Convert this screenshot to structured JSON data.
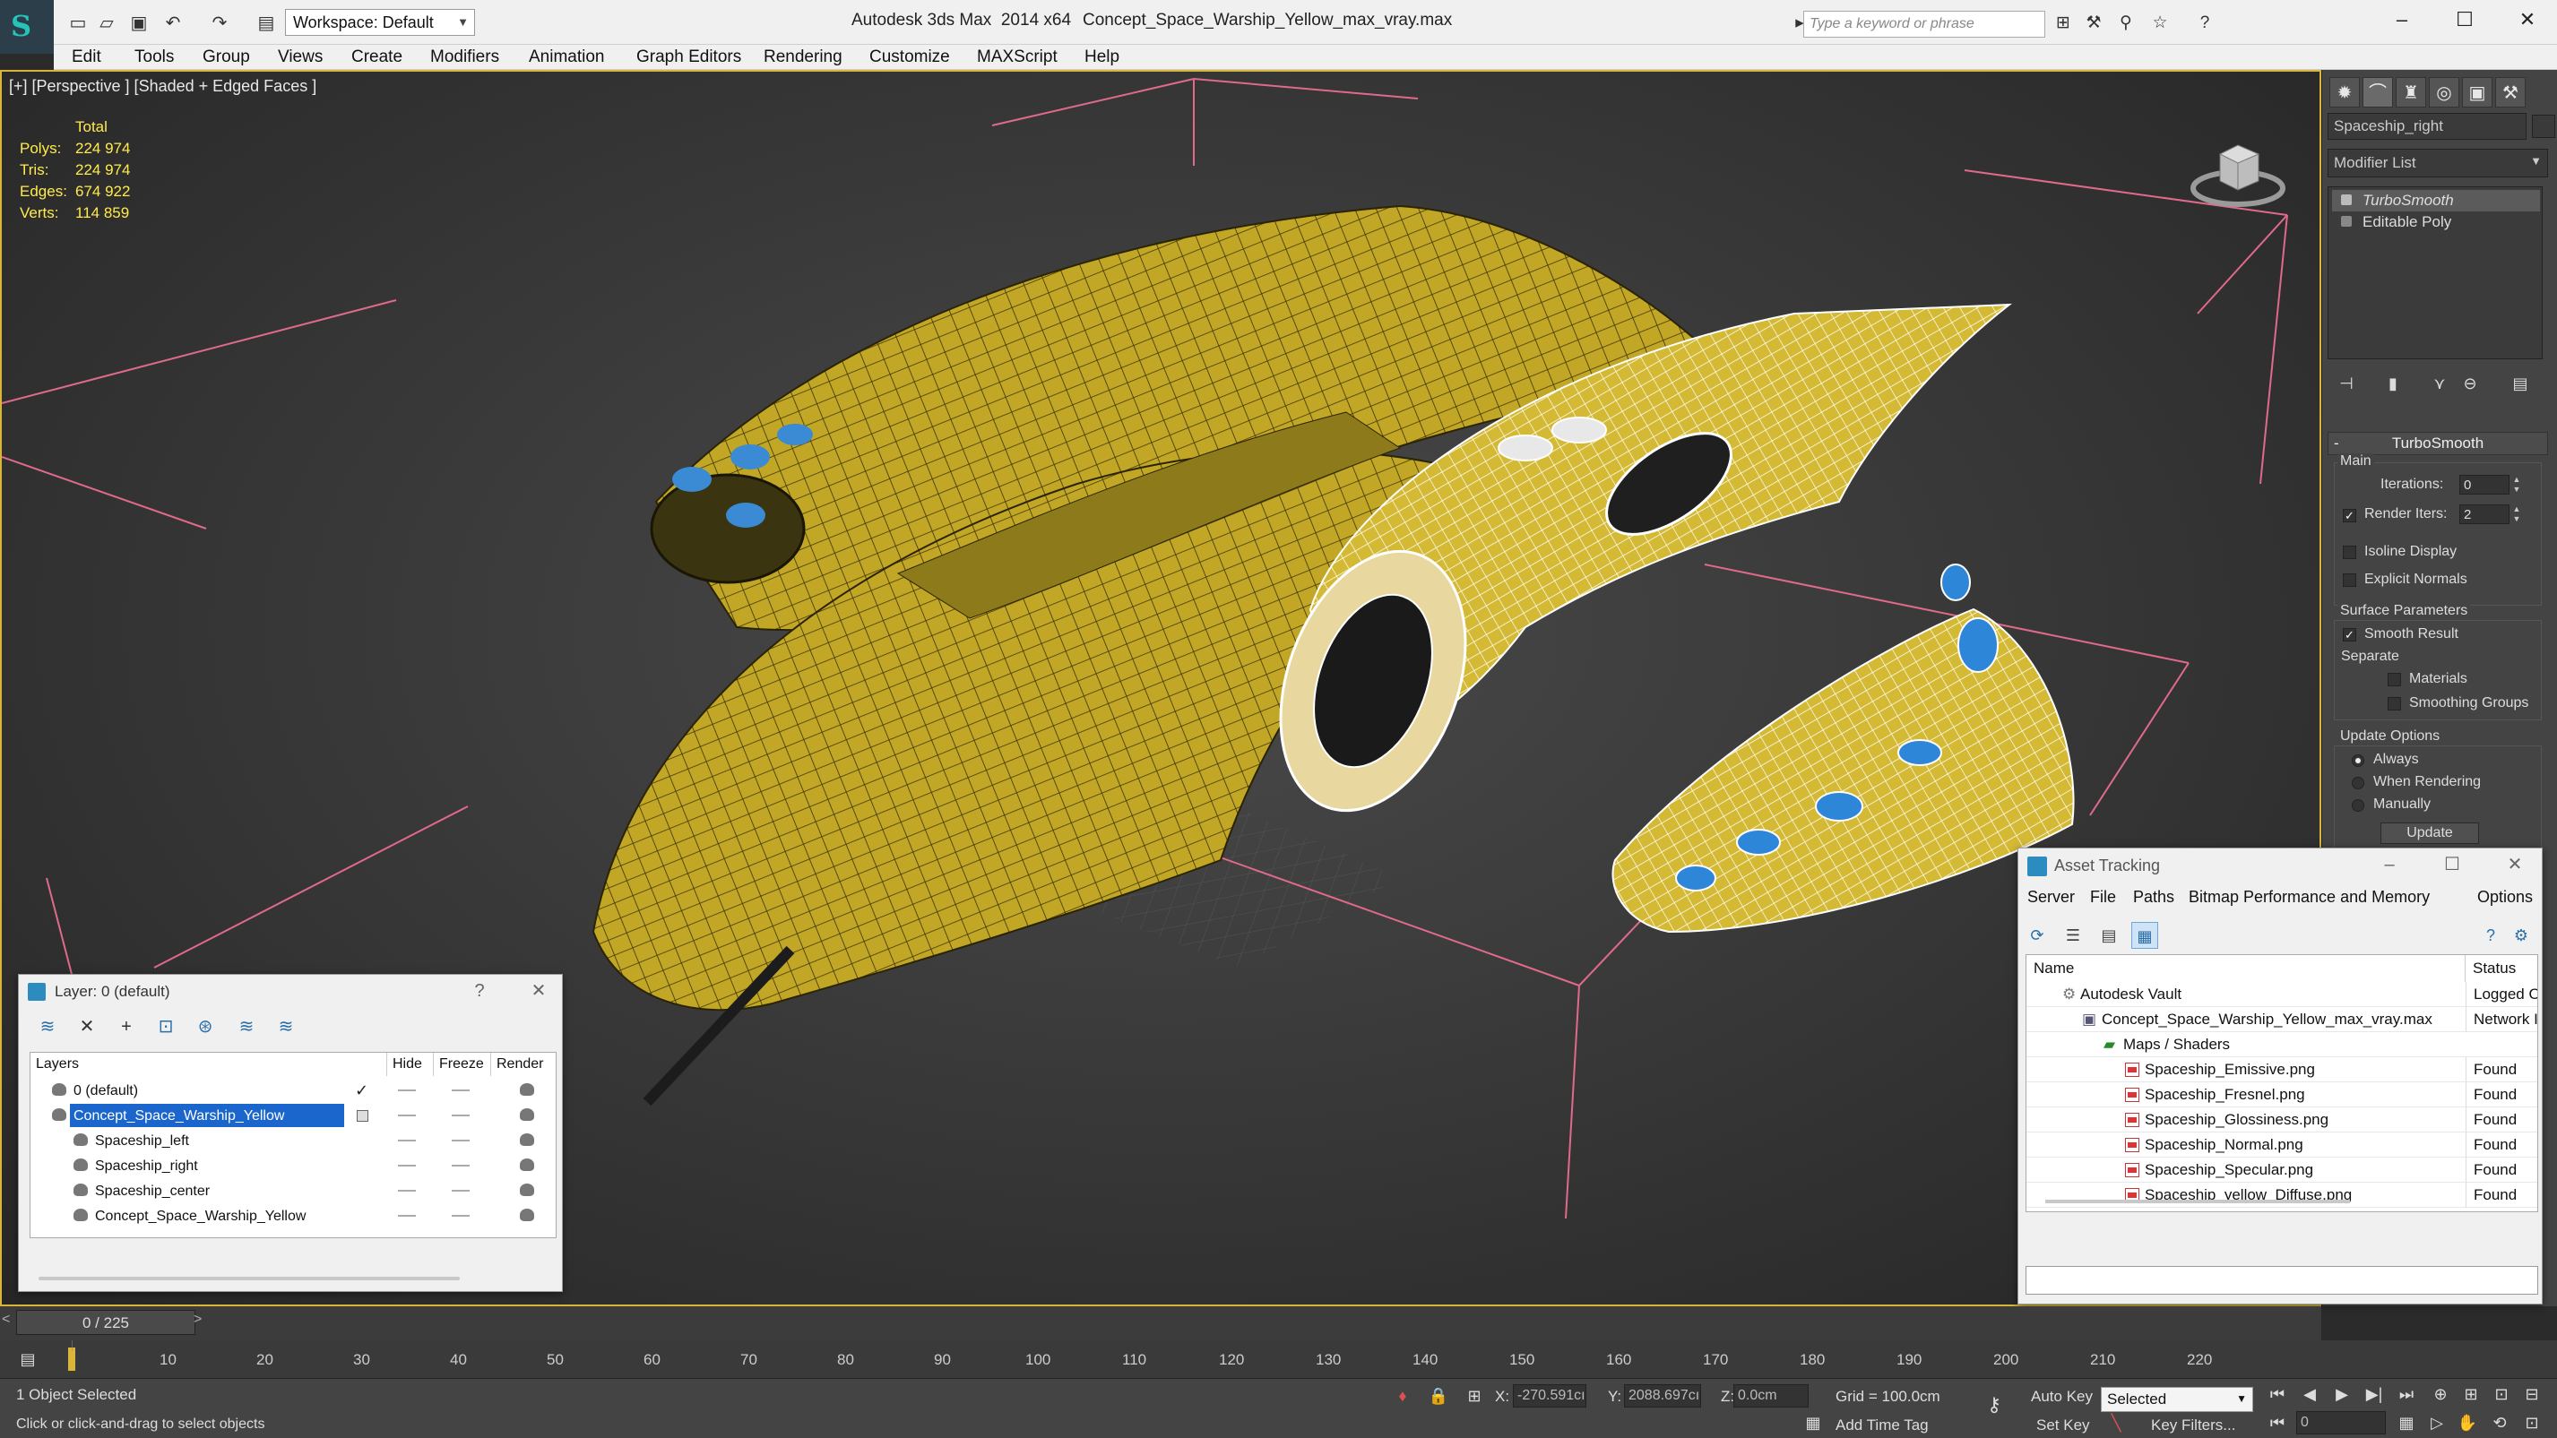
{
  "titlebar": {
    "workspace": "Workspace: Default",
    "app_title": "Autodesk 3ds Max  2014 x64",
    "file_name": "Concept_Space_Warship_Yellow_max_vray.max",
    "search_placeholder": "Type a keyword or phrase"
  },
  "menu": [
    "Edit",
    "Tools",
    "Group",
    "Views",
    "Create",
    "Modifiers",
    "Animation",
    "Graph Editors",
    "Rendering",
    "Customize",
    "MAXScript",
    "Help"
  ],
  "viewport": {
    "label": "[+] [Perspective ] [Shaded + Edged Faces ]",
    "stats": {
      "total": "Total",
      "rows": [
        {
          "k": "Polys:",
          "v": "224 974"
        },
        {
          "k": "Tris:",
          "v": "224 974"
        },
        {
          "k": "Edges:",
          "v": "674 922"
        },
        {
          "k": "Verts:",
          "v": "114 859"
        }
      ]
    },
    "border_color": "#d9b53a",
    "model_color": "#c9ad2a"
  },
  "command_panel": {
    "object_name": "Spaceship_right",
    "modifier_list": "Modifier List",
    "stack": [
      "TurboSmooth",
      "Editable Poly"
    ],
    "rollout": "TurboSmooth",
    "main_label": "Main",
    "iterations_label": "Iterations:",
    "iterations_value": "0",
    "render_iters_label": "Render Iters:",
    "render_iters_value": "2",
    "isoline": "Isoline Display",
    "explicit_normals": "Explicit Normals",
    "surface_params": "Surface Parameters",
    "smooth_result": "Smooth Result",
    "separate": "Separate",
    "materials": "Materials",
    "smoothing_groups": "Smoothing Groups",
    "update_options": "Update Options",
    "always": "Always",
    "when_rendering": "When Rendering",
    "manually": "Manually",
    "update_button": "Update"
  },
  "layer_dialog": {
    "title": "Layer: 0 (default)",
    "columns": [
      "Layers",
      "Hide",
      "Freeze",
      "Render"
    ],
    "rows": [
      "0 (default)",
      "Concept_Space_Warship_Yellow",
      "Spaceship_left",
      "Spaceship_right",
      "Spaceship_center",
      "Concept_Space_Warship_Yellow"
    ]
  },
  "asset_tracking": {
    "title": "Asset Tracking",
    "menu": [
      "Server",
      "File",
      "Paths",
      "Bitmap Performance and Memory",
      "Options"
    ],
    "columns": [
      "Name",
      "Status"
    ],
    "rows": [
      {
        "name": "Autodesk Vault",
        "status": "Logged O"
      },
      {
        "name": "Concept_Space_Warship_Yellow_max_vray.max",
        "status": "Network I"
      },
      {
        "name": "Maps / Shaders",
        "status": ""
      },
      {
        "name": "Spaceship_Emissive.png",
        "status": "Found"
      },
      {
        "name": "Spaceship_Fresnel.png",
        "status": "Found"
      },
      {
        "name": "Spaceship_Glossiness.png",
        "status": "Found"
      },
      {
        "name": "Spaceship_Normal.png",
        "status": "Found"
      },
      {
        "name": "Spaceship_Specular.png",
        "status": "Found"
      },
      {
        "name": "Spaceship_yellow_Diffuse.png",
        "status": "Found"
      }
    ]
  },
  "timeline": {
    "frame": "0 / 225",
    "ticks": [
      "10",
      "20",
      "30",
      "40",
      "50",
      "60",
      "70",
      "80",
      "90",
      "100",
      "110",
      "120",
      "130",
      "140",
      "150",
      "160",
      "170",
      "180",
      "190",
      "200",
      "210",
      "220"
    ]
  },
  "statusbar": {
    "selection": "1 Object Selected",
    "prompt": "Click or click-and-drag to select objects",
    "x_label": "X:",
    "x_value": "-270.591cı",
    "y_label": "Y:",
    "y_value": "2088.697cı",
    "z_label": "Z:",
    "z_value": "0.0cm",
    "grid": "Grid = 100.0cm",
    "add_time_tag": "Add Time Tag",
    "auto_key": "Auto Key",
    "set_key": "Set Key",
    "selected": "Selected",
    "key_filters": "Key Filters...",
    "frame_field": "0"
  }
}
